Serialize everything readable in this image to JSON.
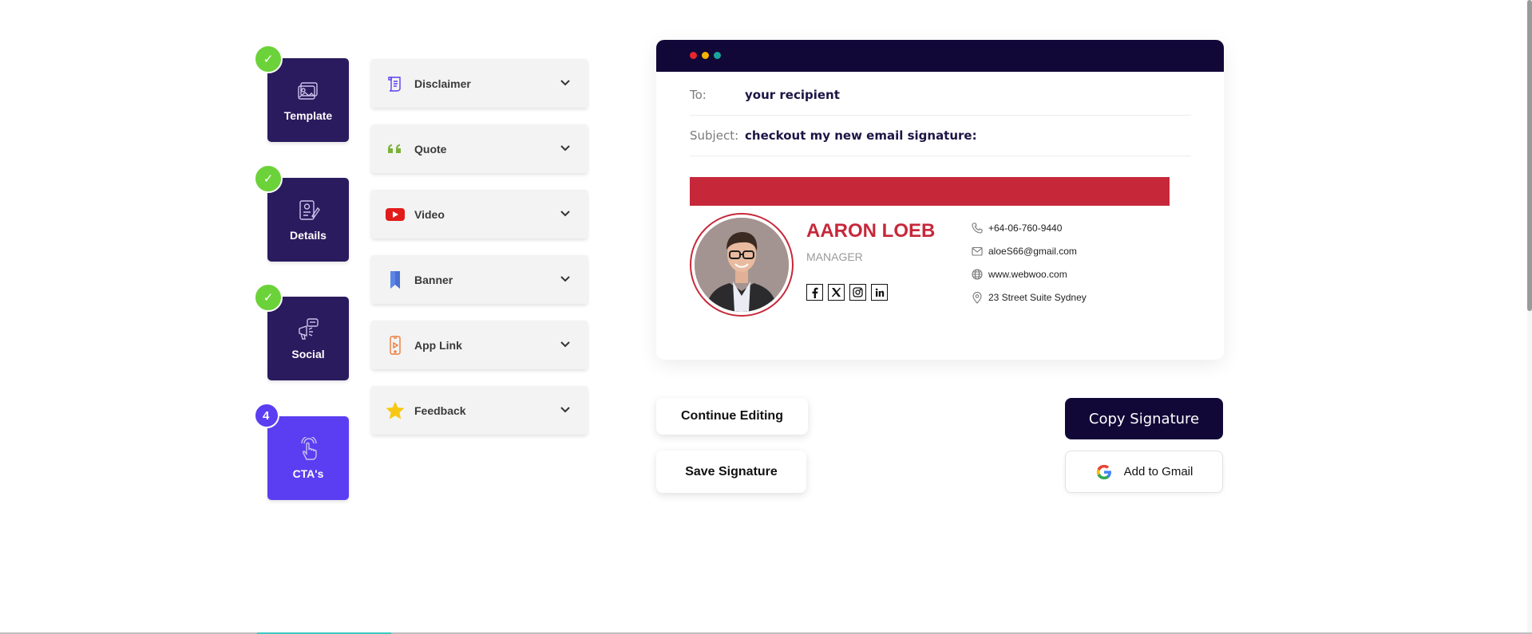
{
  "steps": [
    {
      "label": "Template",
      "status": "done",
      "icon": "image-frame-icon"
    },
    {
      "label": "Details",
      "status": "done",
      "icon": "document-edit-icon"
    },
    {
      "label": "Social",
      "status": "done",
      "icon": "megaphone-icon"
    },
    {
      "label": "CTA's",
      "status": "active",
      "number": "4",
      "icon": "tap-hand-icon"
    }
  ],
  "accordion": [
    {
      "label": "Disclaimer",
      "icon": "scroll-icon"
    },
    {
      "label": "Quote",
      "icon": "quote-icon"
    },
    {
      "label": "Video",
      "icon": "youtube-icon"
    },
    {
      "label": "Banner",
      "icon": "bookmark-ribbon-icon"
    },
    {
      "label": "App Link",
      "icon": "mobile-app-icon"
    },
    {
      "label": "Feedback",
      "icon": "star-icon"
    }
  ],
  "email": {
    "to_label": "To:",
    "to_value": "your recipient",
    "subject_label": "Subject:",
    "subject_value": "checkout my new email signature:"
  },
  "signature": {
    "name": "AARON LOEB",
    "title": "MANAGER",
    "phone": "+64-06-760-9440",
    "email": "aloeS66@gmail.com",
    "website": "www.webwoo.com",
    "address": "23 Street Suite Sydney",
    "socials": [
      "facebook-icon",
      "x-icon",
      "instagram-icon",
      "linkedin-icon"
    ]
  },
  "buttons": {
    "continue_editing": "Continue Editing",
    "save_signature": "Save Signature",
    "copy_signature": "Copy Signature",
    "add_to_gmail": "Add to Gmail"
  },
  "colors": {
    "step_bg": "#2a1b5e",
    "step_active": "#5b3ef2",
    "check_green": "#6cd23a",
    "brand_red": "#c6283a",
    "navy": "#120838",
    "window_dots": [
      "#e8262b",
      "#f4b400",
      "#1aa59a"
    ]
  }
}
